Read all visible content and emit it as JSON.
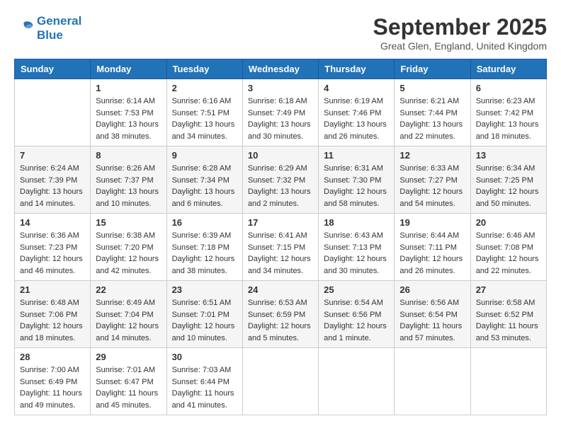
{
  "logo": {
    "line1": "General",
    "line2": "Blue"
  },
  "title": "September 2025",
  "location": "Great Glen, England, United Kingdom",
  "weekdays": [
    "Sunday",
    "Monday",
    "Tuesday",
    "Wednesday",
    "Thursday",
    "Friday",
    "Saturday"
  ],
  "weeks": [
    [
      {
        "day": "",
        "sunrise": "",
        "sunset": "",
        "daylight": ""
      },
      {
        "day": "1",
        "sunrise": "Sunrise: 6:14 AM",
        "sunset": "Sunset: 7:53 PM",
        "daylight": "Daylight: 13 hours and 38 minutes."
      },
      {
        "day": "2",
        "sunrise": "Sunrise: 6:16 AM",
        "sunset": "Sunset: 7:51 PM",
        "daylight": "Daylight: 13 hours and 34 minutes."
      },
      {
        "day": "3",
        "sunrise": "Sunrise: 6:18 AM",
        "sunset": "Sunset: 7:49 PM",
        "daylight": "Daylight: 13 hours and 30 minutes."
      },
      {
        "day": "4",
        "sunrise": "Sunrise: 6:19 AM",
        "sunset": "Sunset: 7:46 PM",
        "daylight": "Daylight: 13 hours and 26 minutes."
      },
      {
        "day": "5",
        "sunrise": "Sunrise: 6:21 AM",
        "sunset": "Sunset: 7:44 PM",
        "daylight": "Daylight: 13 hours and 22 minutes."
      },
      {
        "day": "6",
        "sunrise": "Sunrise: 6:23 AM",
        "sunset": "Sunset: 7:42 PM",
        "daylight": "Daylight: 13 hours and 18 minutes."
      }
    ],
    [
      {
        "day": "7",
        "sunrise": "Sunrise: 6:24 AM",
        "sunset": "Sunset: 7:39 PM",
        "daylight": "Daylight: 13 hours and 14 minutes."
      },
      {
        "day": "8",
        "sunrise": "Sunrise: 6:26 AM",
        "sunset": "Sunset: 7:37 PM",
        "daylight": "Daylight: 13 hours and 10 minutes."
      },
      {
        "day": "9",
        "sunrise": "Sunrise: 6:28 AM",
        "sunset": "Sunset: 7:34 PM",
        "daylight": "Daylight: 13 hours and 6 minutes."
      },
      {
        "day": "10",
        "sunrise": "Sunrise: 6:29 AM",
        "sunset": "Sunset: 7:32 PM",
        "daylight": "Daylight: 13 hours and 2 minutes."
      },
      {
        "day": "11",
        "sunrise": "Sunrise: 6:31 AM",
        "sunset": "Sunset: 7:30 PM",
        "daylight": "Daylight: 12 hours and 58 minutes."
      },
      {
        "day": "12",
        "sunrise": "Sunrise: 6:33 AM",
        "sunset": "Sunset: 7:27 PM",
        "daylight": "Daylight: 12 hours and 54 minutes."
      },
      {
        "day": "13",
        "sunrise": "Sunrise: 6:34 AM",
        "sunset": "Sunset: 7:25 PM",
        "daylight": "Daylight: 12 hours and 50 minutes."
      }
    ],
    [
      {
        "day": "14",
        "sunrise": "Sunrise: 6:36 AM",
        "sunset": "Sunset: 7:23 PM",
        "daylight": "Daylight: 12 hours and 46 minutes."
      },
      {
        "day": "15",
        "sunrise": "Sunrise: 6:38 AM",
        "sunset": "Sunset: 7:20 PM",
        "daylight": "Daylight: 12 hours and 42 minutes."
      },
      {
        "day": "16",
        "sunrise": "Sunrise: 6:39 AM",
        "sunset": "Sunset: 7:18 PM",
        "daylight": "Daylight: 12 hours and 38 minutes."
      },
      {
        "day": "17",
        "sunrise": "Sunrise: 6:41 AM",
        "sunset": "Sunset: 7:15 PM",
        "daylight": "Daylight: 12 hours and 34 minutes."
      },
      {
        "day": "18",
        "sunrise": "Sunrise: 6:43 AM",
        "sunset": "Sunset: 7:13 PM",
        "daylight": "Daylight: 12 hours and 30 minutes."
      },
      {
        "day": "19",
        "sunrise": "Sunrise: 6:44 AM",
        "sunset": "Sunset: 7:11 PM",
        "daylight": "Daylight: 12 hours and 26 minutes."
      },
      {
        "day": "20",
        "sunrise": "Sunrise: 6:46 AM",
        "sunset": "Sunset: 7:08 PM",
        "daylight": "Daylight: 12 hours and 22 minutes."
      }
    ],
    [
      {
        "day": "21",
        "sunrise": "Sunrise: 6:48 AM",
        "sunset": "Sunset: 7:06 PM",
        "daylight": "Daylight: 12 hours and 18 minutes."
      },
      {
        "day": "22",
        "sunrise": "Sunrise: 6:49 AM",
        "sunset": "Sunset: 7:04 PM",
        "daylight": "Daylight: 12 hours and 14 minutes."
      },
      {
        "day": "23",
        "sunrise": "Sunrise: 6:51 AM",
        "sunset": "Sunset: 7:01 PM",
        "daylight": "Daylight: 12 hours and 10 minutes."
      },
      {
        "day": "24",
        "sunrise": "Sunrise: 6:53 AM",
        "sunset": "Sunset: 6:59 PM",
        "daylight": "Daylight: 12 hours and 5 minutes."
      },
      {
        "day": "25",
        "sunrise": "Sunrise: 6:54 AM",
        "sunset": "Sunset: 6:56 PM",
        "daylight": "Daylight: 12 hours and 1 minute."
      },
      {
        "day": "26",
        "sunrise": "Sunrise: 6:56 AM",
        "sunset": "Sunset: 6:54 PM",
        "daylight": "Daylight: 11 hours and 57 minutes."
      },
      {
        "day": "27",
        "sunrise": "Sunrise: 6:58 AM",
        "sunset": "Sunset: 6:52 PM",
        "daylight": "Daylight: 11 hours and 53 minutes."
      }
    ],
    [
      {
        "day": "28",
        "sunrise": "Sunrise: 7:00 AM",
        "sunset": "Sunset: 6:49 PM",
        "daylight": "Daylight: 11 hours and 49 minutes."
      },
      {
        "day": "29",
        "sunrise": "Sunrise: 7:01 AM",
        "sunset": "Sunset: 6:47 PM",
        "daylight": "Daylight: 11 hours and 45 minutes."
      },
      {
        "day": "30",
        "sunrise": "Sunrise: 7:03 AM",
        "sunset": "Sunset: 6:44 PM",
        "daylight": "Daylight: 11 hours and 41 minutes."
      },
      {
        "day": "",
        "sunrise": "",
        "sunset": "",
        "daylight": ""
      },
      {
        "day": "",
        "sunrise": "",
        "sunset": "",
        "daylight": ""
      },
      {
        "day": "",
        "sunrise": "",
        "sunset": "",
        "daylight": ""
      },
      {
        "day": "",
        "sunrise": "",
        "sunset": "",
        "daylight": ""
      }
    ]
  ]
}
